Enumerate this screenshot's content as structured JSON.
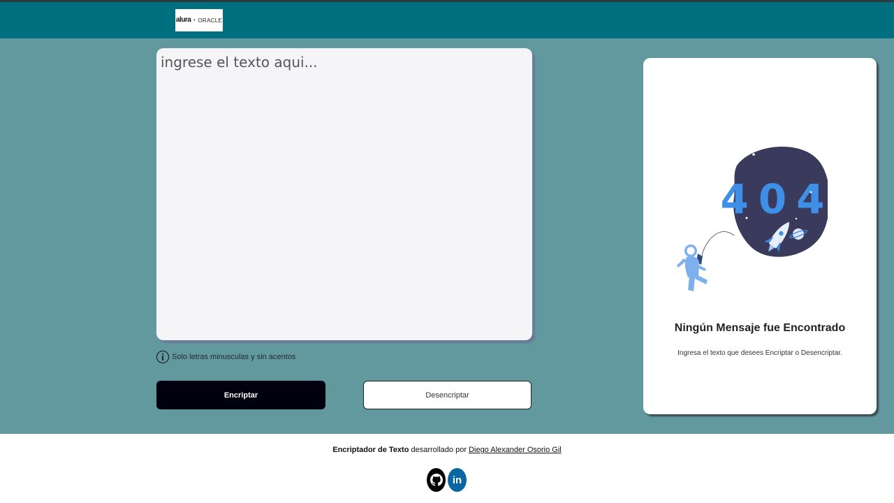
{
  "header": {
    "logo": {
      "alura": "alura",
      "plus": "+",
      "oracle": "ORACLE",
      "icon": "alura-oracle-logo"
    }
  },
  "editor": {
    "placeholder": "ingrese el texto aqui...",
    "value": ""
  },
  "hint": {
    "icon": "info-icon",
    "text": "Solo letras minusculas y sin acentos"
  },
  "buttons": {
    "encrypt_label": "Encriptar",
    "decrypt_label": "Desencriptar"
  },
  "result": {
    "illustration": {
      "icon": "astronaut-404-illustration",
      "code_digits": [
        "4",
        "0",
        "4"
      ]
    },
    "title": "Ningún Mensaje fue Encontrado",
    "subtitle": "Ingresa el texto que desees Encriptar o Desencriptar."
  },
  "footer": {
    "brand": "Encriptador de Texto",
    "developed_by": "desarrollado por",
    "author": "Diego Alexander Osorio Gil",
    "social": [
      {
        "icon": "github-icon"
      },
      {
        "icon": "linkedin-icon",
        "text": "in"
      }
    ]
  },
  "colors": {
    "header_bg": "#007080",
    "main_bg": "#62999f",
    "encrypt_btn": "#01000f",
    "digits": "#3d8fe8",
    "planet_bg": "#3a3b5c"
  }
}
